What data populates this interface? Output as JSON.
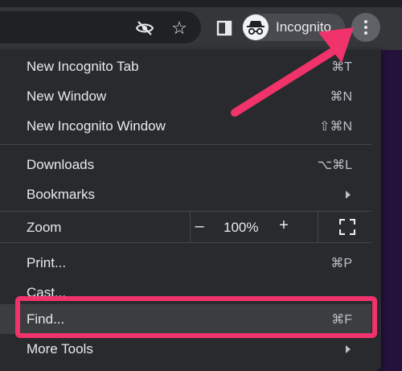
{
  "toolbar": {
    "profile_label": "Incognito",
    "icons": [
      "eye-off-icon",
      "star-icon",
      "side-panel-icon",
      "incognito-avatar-icon",
      "more-vert-icon"
    ]
  },
  "menu": {
    "items": [
      {
        "label": "New Incognito Tab",
        "shortcut": "⌘T"
      },
      {
        "label": "New Window",
        "shortcut": "⌘N"
      },
      {
        "label": "New Incognito Window",
        "shortcut": "⇧⌘N"
      },
      {
        "label": "Downloads",
        "shortcut": "⌥⌘L"
      },
      {
        "label": "Bookmarks",
        "shortcut": ""
      },
      {
        "label": "Print...",
        "shortcut": "⌘P"
      },
      {
        "label": "Cast...",
        "shortcut": ""
      },
      {
        "label": "Find...",
        "shortcut": "⌘F"
      },
      {
        "label": "More Tools",
        "shortcut": ""
      }
    ],
    "zoom": {
      "label": "Zoom",
      "minus": "–",
      "value": "100%",
      "plus": "+"
    }
  },
  "annotation": {
    "highlight_color": "#f0336a",
    "highlighted_item": "Find..."
  }
}
